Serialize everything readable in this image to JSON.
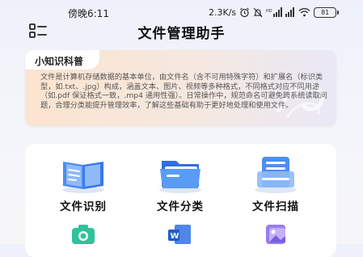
{
  "status_bar": {
    "time": "傍晚6:11",
    "network_speed": "2.3K/s",
    "battery": "81"
  },
  "header": {
    "title": "文件管理助手"
  },
  "tip": {
    "title": "小知识科普",
    "text": "文件是计算机存储数据的基本单位，由文件名（含不可用特殊字符）和扩展名（标识类型，如.txt、.jpg）构成，涵盖文本、图片、视频等多种格式，不同格式对应不同用途（如.pdf 保证格式一致，.mp4 通用性强）。日常操作中，规范命名可避免跨系统读取问题，合理分类能提升管理效率，了解这些基础有助于更好地处理和使用文件。"
  },
  "tools": [
    {
      "label": "文件识别",
      "icon": "book-icon"
    },
    {
      "label": "文件分类",
      "icon": "folder-icon"
    },
    {
      "label": "文件扫描",
      "icon": "document-scan-icon"
    }
  ],
  "tools_row2": [
    {
      "icon": "camera-icon"
    },
    {
      "icon": "word-document-icon"
    },
    {
      "icon": "image-icon"
    }
  ]
}
